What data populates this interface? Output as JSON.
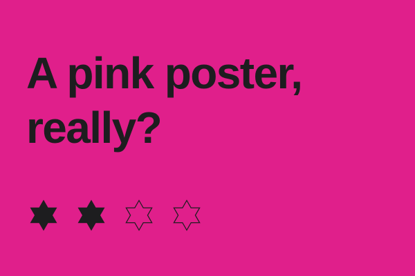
{
  "colors": {
    "background": "#e01f8b",
    "ink": "#1d1d1f"
  },
  "headline": {
    "line1": "A pink poster,",
    "line2": "really?"
  },
  "rating": {
    "filled": 2,
    "total": 4,
    "icon": "six-pointed-star-icon"
  }
}
